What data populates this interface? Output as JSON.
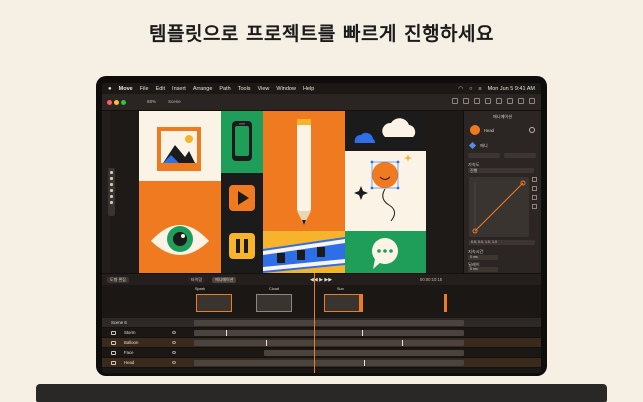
{
  "headline": "템플릿으로 프로젝트를 빠르게 진행하세요",
  "menubar": {
    "app": "Move",
    "items": [
      "File",
      "Edit",
      "Insert",
      "Arrange",
      "Path",
      "Tools",
      "View",
      "Window",
      "Help"
    ],
    "datetime": "Mon Jun 5  9:41 AM"
  },
  "toolbar": {
    "zoom": "88%",
    "layer": "Scene"
  },
  "inspector": {
    "title": "애니메이션",
    "layer_name": "Head",
    "section_anim": "애니",
    "label_ease": "가속도",
    "ease_value": "진행",
    "curve_values": "0.5, 0.0, 1.0, 1.0",
    "label_opacity": "지속시간",
    "label_delay": "딜레이",
    "value_a": "0 ms",
    "value_b": "0 ms"
  },
  "transport": {
    "left_button": "도형 편집",
    "mid_button": "타이밍",
    "mid_button2": "애니메이션",
    "time": "00:00:10:15"
  },
  "timeline": {
    "scene_label": "Scene 6",
    "layers": [
      "Storm",
      "Balloon",
      "Face",
      "Head"
    ],
    "thumb_labels": [
      "Spark",
      "Cloud",
      "Sun"
    ]
  },
  "colors": {
    "accent": "#f07a1f",
    "canvas_green": "#1f9e5a",
    "canvas_cream": "#fbf4e6",
    "canvas_blue": "#2e6fe8"
  }
}
